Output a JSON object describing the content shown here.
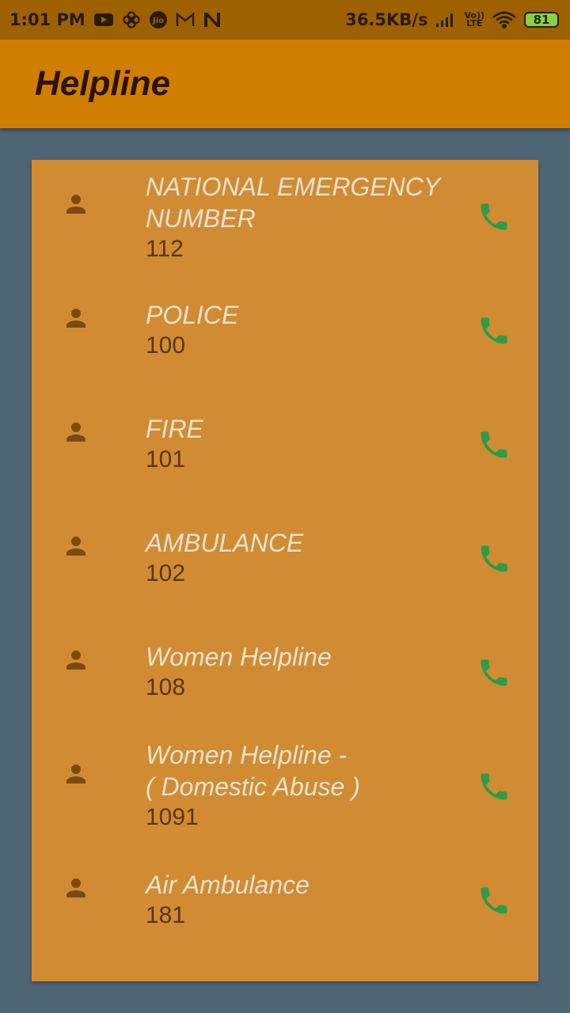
{
  "status_bar": {
    "time": "1:01 PM",
    "net_speed": "36.5KB/s",
    "volte_top": "Vo))",
    "volte_bottom": "LTE",
    "battery": "81",
    "notif_icons": [
      "youtube-icon",
      "pinwheel-icon",
      "jio-icon",
      "gmail-icon",
      "n-app-icon"
    ]
  },
  "app_bar": {
    "title": "Helpline"
  },
  "colors": {
    "status_bar": "#9e6100",
    "app_bar": "#d07e00",
    "background": "#4e6575",
    "card": "#d18b33",
    "call_icon": "#2e9a4a",
    "person_icon": "#7a4a10"
  },
  "helplines": [
    {
      "name": "NATIONAL EMERGENCY\nNUMBER",
      "number": "112"
    },
    {
      "name": "POLICE",
      "number": "100"
    },
    {
      "name": "FIRE",
      "number": "101"
    },
    {
      "name": "AMBULANCE",
      "number": "102"
    },
    {
      "name": "Women Helpline",
      "number": "108"
    },
    {
      "name": "Women Helpline -\n( Domestic Abuse )",
      "number": "1091"
    },
    {
      "name": "Air Ambulance",
      "number": "181"
    }
  ]
}
